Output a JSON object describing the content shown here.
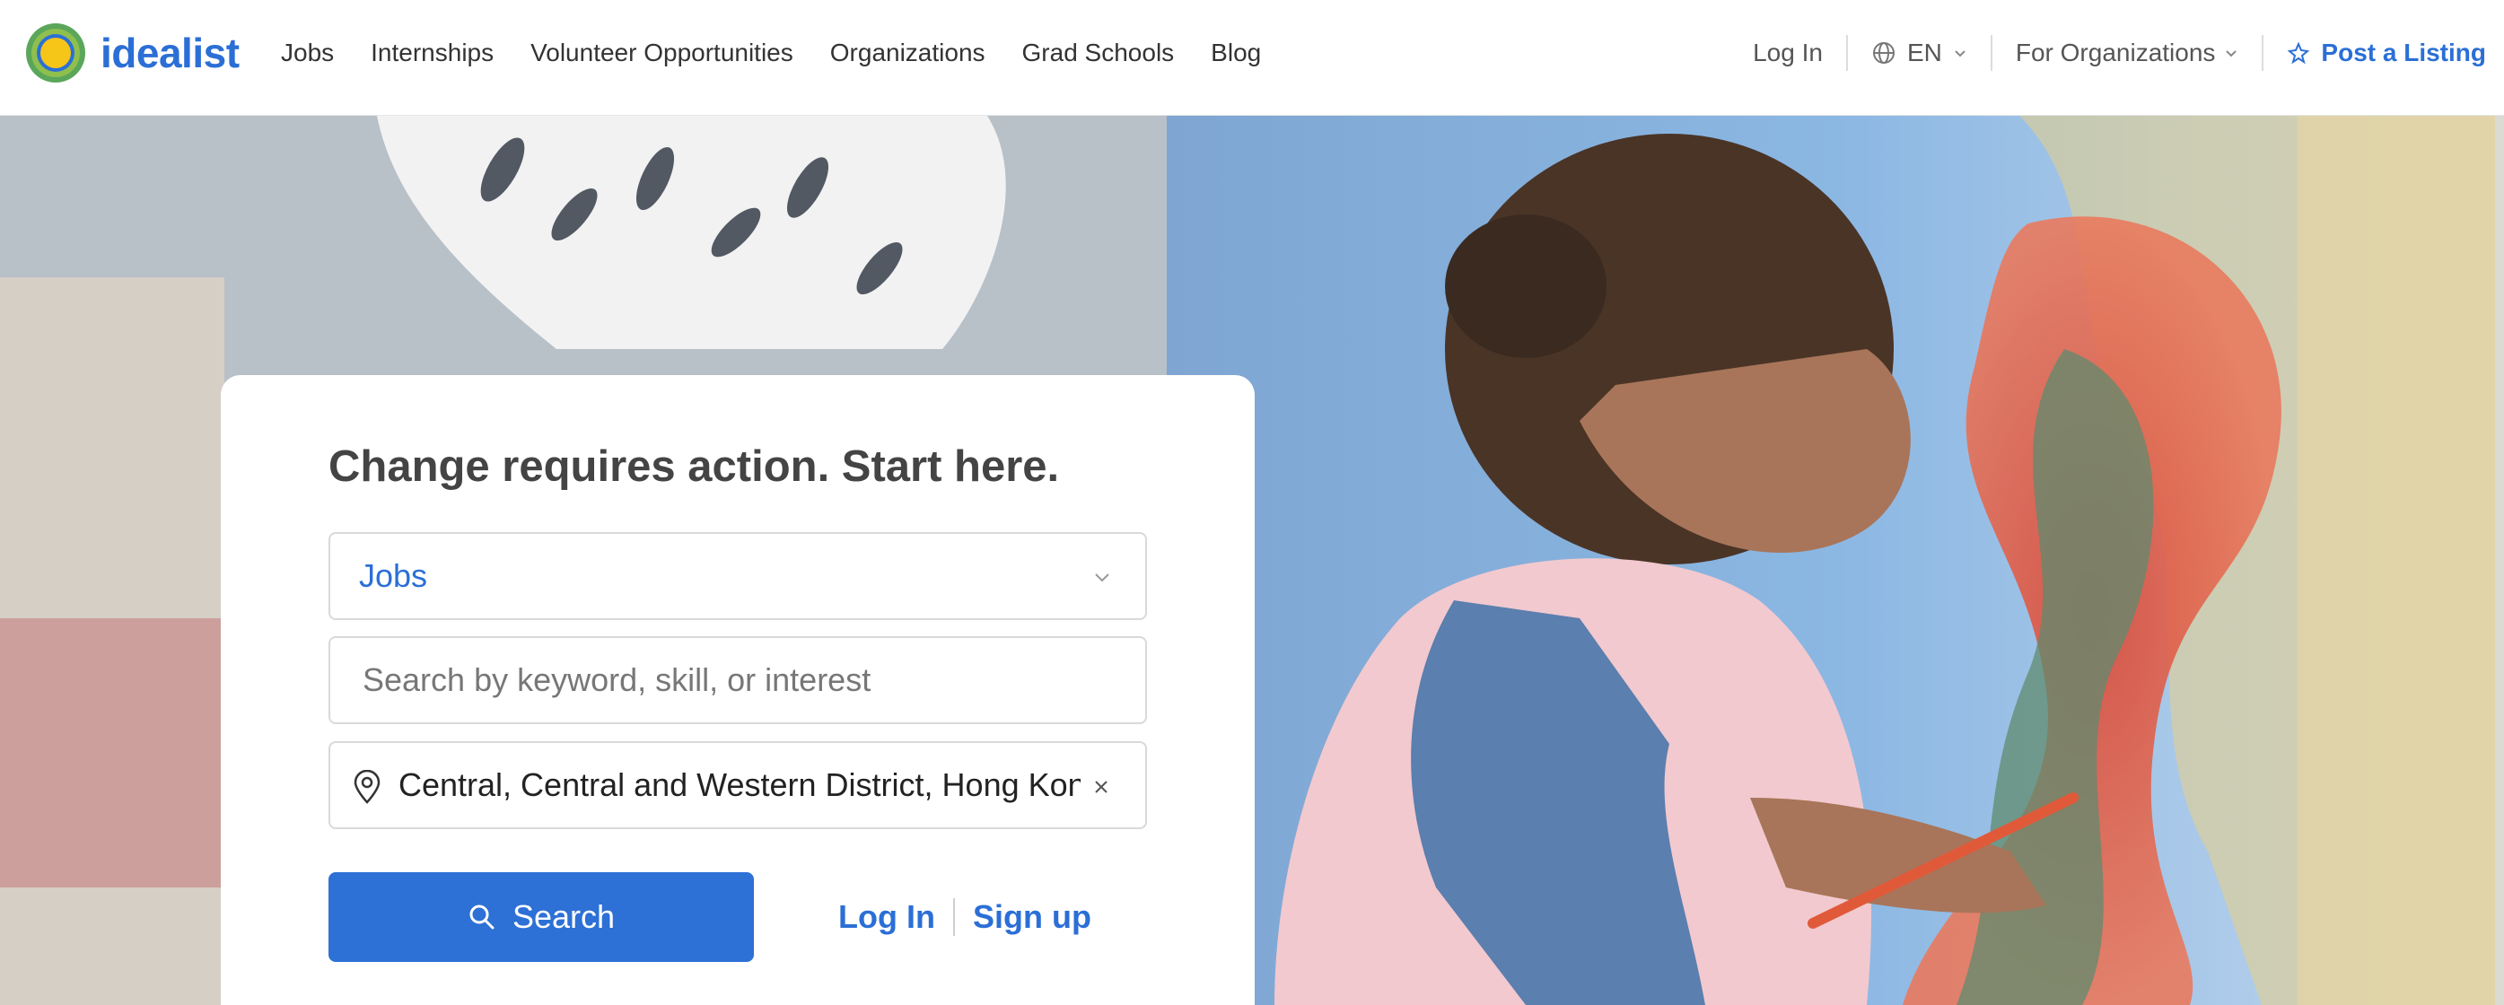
{
  "header": {
    "logo_text": "idealist",
    "nav": [
      "Jobs",
      "Internships",
      "Volunteer Opportunities",
      "Organizations",
      "Grad Schools",
      "Blog"
    ],
    "login": "Log In",
    "language": "EN",
    "for_orgs": "For Organizations",
    "post_listing": "Post a Listing"
  },
  "search": {
    "title": "Change requires action. Start here.",
    "type_value": "Jobs",
    "keyword_placeholder": "Search by keyword, skill, or interest",
    "keyword_value": "",
    "location_value": "Central, Central and Western District, Hong Kong",
    "search_button": "Search",
    "login": "Log In",
    "signup": "Sign up"
  },
  "colors": {
    "brand_blue": "#2b6fd6",
    "button_blue": "#2d70d6",
    "logo_yellow": "#f5c518",
    "logo_green": "#5aa65a"
  },
  "icons": [
    "globe-icon",
    "chevron-down-icon",
    "post-icon",
    "location-pin-icon",
    "clear-icon",
    "search-icon"
  ]
}
